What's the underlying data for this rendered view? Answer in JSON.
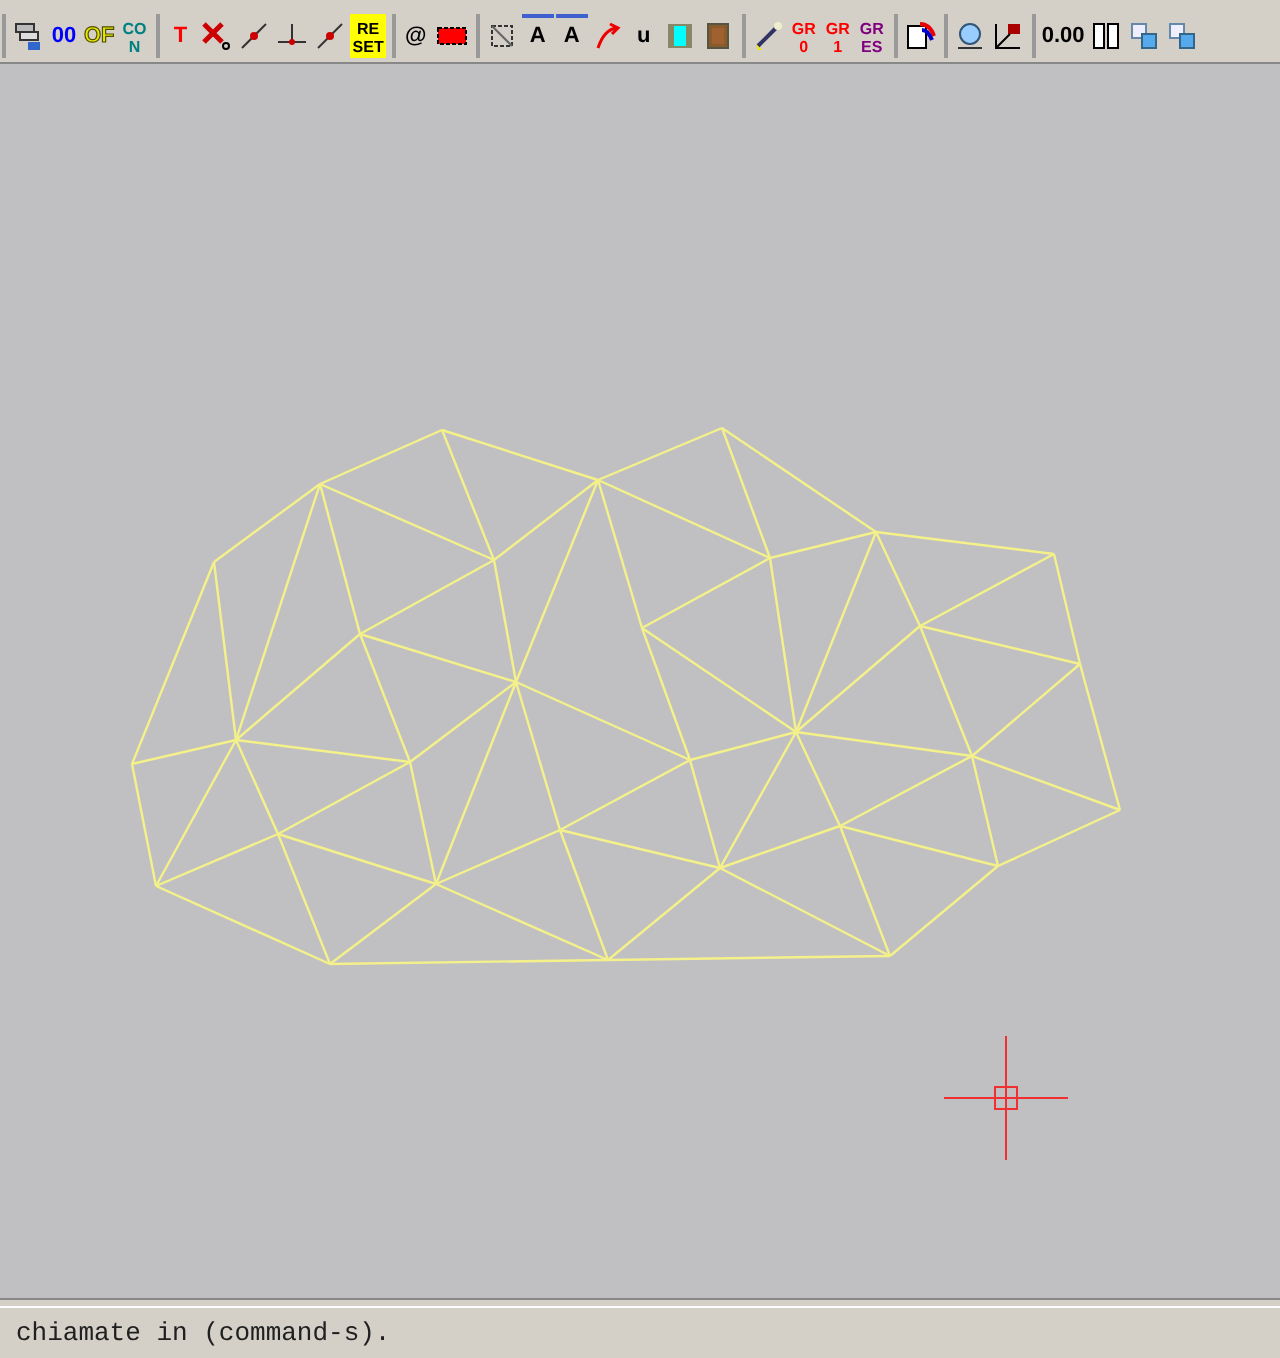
{
  "toolbar": {
    "groups": [
      [
        {
          "kind": "layers"
        },
        {
          "kind": "text",
          "lines": [
            "00"
          ],
          "color": "#0000ff"
        },
        {
          "kind": "text",
          "lines": [
            "OF"
          ],
          "color": "#e8e800",
          "outlined": true
        },
        {
          "kind": "text",
          "lines": [
            "CO",
            "N"
          ],
          "color": "#008080"
        }
      ],
      [
        {
          "kind": "text",
          "lines": [
            "T"
          ],
          "color": "#ff0000"
        },
        {
          "kind": "cross"
        },
        {
          "kind": "line"
        },
        {
          "kind": "perp"
        },
        {
          "kind": "line"
        },
        {
          "kind": "text",
          "lines": [
            "RE",
            "SET"
          ],
          "color": "#000000",
          "highlighted": true
        }
      ],
      [
        {
          "kind": "text",
          "lines": [
            "@"
          ],
          "color": "#000000"
        },
        {
          "kind": "redbar"
        }
      ],
      [
        {
          "kind": "frame"
        },
        {
          "kind": "text",
          "lines": [
            "A"
          ],
          "color": "#000000",
          "overline": true
        },
        {
          "kind": "text",
          "lines": [
            "A"
          ],
          "color": "#000000",
          "overline": true
        },
        {
          "kind": "arrow"
        },
        {
          "kind": "text",
          "lines": [
            "u"
          ],
          "color": "#000000"
        },
        {
          "kind": "cyanbox"
        },
        {
          "kind": "brownbox"
        }
      ],
      [
        {
          "kind": "brush"
        },
        {
          "kind": "text",
          "lines": [
            "GR",
            "0"
          ],
          "color": "#ff0000"
        },
        {
          "kind": "text",
          "lines": [
            "GR",
            "1"
          ],
          "color": "#ff0000"
        },
        {
          "kind": "text",
          "lines": [
            "GR",
            "ES"
          ],
          "color": "#800080"
        }
      ],
      [
        {
          "kind": "palette"
        }
      ],
      [
        {
          "kind": "globe"
        },
        {
          "kind": "axis"
        }
      ],
      [
        {
          "kind": "text",
          "lines": [
            "0.00"
          ],
          "color": "#000000"
        },
        {
          "kind": "columns"
        },
        {
          "kind": "copy"
        },
        {
          "kind": "copy"
        }
      ]
    ]
  },
  "status_bar": {
    "text": "chiamate in (command-s)."
  }
}
